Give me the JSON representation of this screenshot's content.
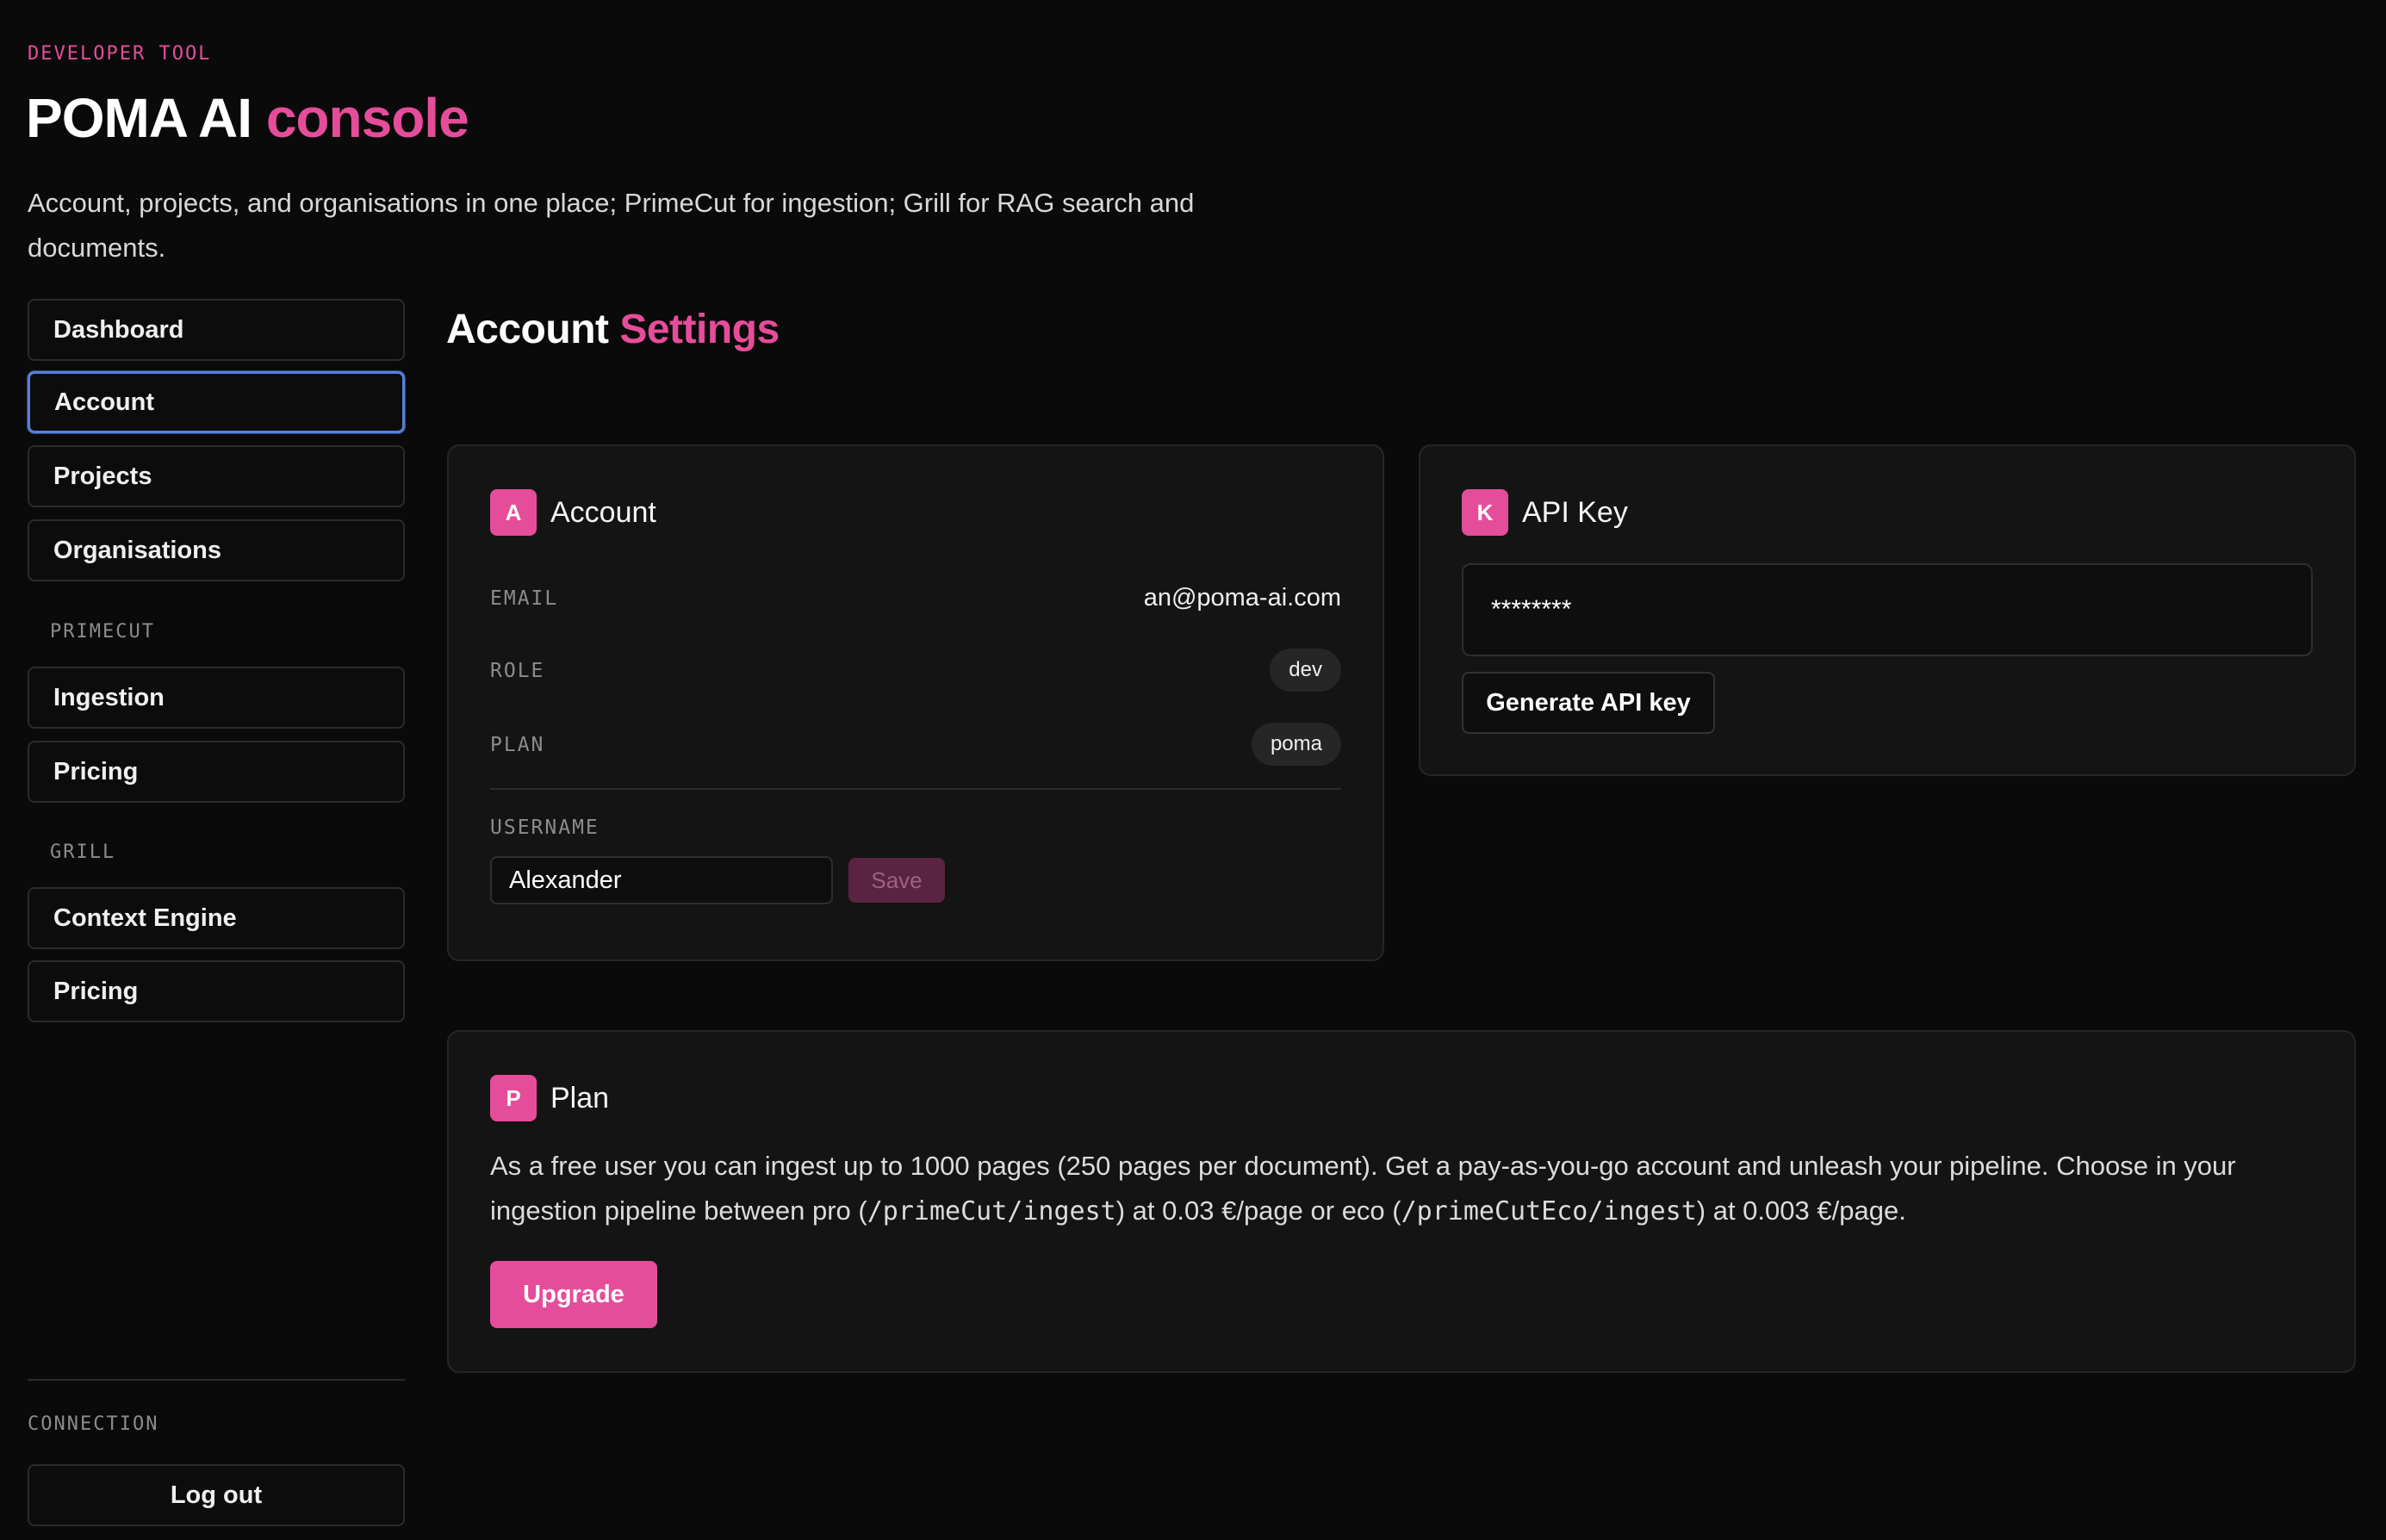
{
  "header": {
    "eyebrow": "DEVELOPER TOOL",
    "title_main": "POMA AI",
    "title_accent": "console",
    "subtitle": "Account, projects, and organisations in one place; PrimeCut for ingestion; Grill for RAG search and documents."
  },
  "sidebar": {
    "items": [
      {
        "label": "Dashboard"
      },
      {
        "label": "Account",
        "active": true
      },
      {
        "label": "Projects"
      },
      {
        "label": "Organisations"
      }
    ],
    "primecut": {
      "section_label": "PRIMECUT",
      "items": [
        {
          "label": "Ingestion"
        },
        {
          "label": "Pricing"
        }
      ]
    },
    "grill": {
      "section_label": "GRILL",
      "items": [
        {
          "label": "Context Engine"
        },
        {
          "label": "Pricing"
        }
      ]
    },
    "connection_label": "CONNECTION",
    "logout_label": "Log out"
  },
  "main": {
    "title_main": "Account",
    "title_accent": "Settings",
    "account_card": {
      "badge": "A",
      "title": "Account",
      "email_label": "EMAIL",
      "email": "an@poma-ai.com",
      "role_label": "ROLE",
      "role": "dev",
      "plan_label": "PLAN",
      "plan": "poma",
      "username_label": "USERNAME",
      "username": "Alexander",
      "save_label": "Save"
    },
    "api_card": {
      "badge": "K",
      "title": "API Key",
      "key_value": "********",
      "generate_label": "Generate API key"
    },
    "plan_card": {
      "badge": "P",
      "title": "Plan",
      "text_1": "As a free user you can ingest up to 1000 pages (250 pages per document). Get a pay-as-you-go account and unleash your pipeline. Choose in your ingestion pipeline between pro (",
      "code_1": "/primeCut/ingest",
      "text_2": ") at 0.03 €/page or eco (",
      "code_2": "/primeCutEco/ingest",
      "text_3": ") at 0.003 €/page.",
      "upgrade_label": "Upgrade"
    }
  },
  "colors": {
    "accent": "#e54d9a",
    "background": "#0a0a0a",
    "card": "#141414",
    "active_border": "#5a7fd8"
  }
}
